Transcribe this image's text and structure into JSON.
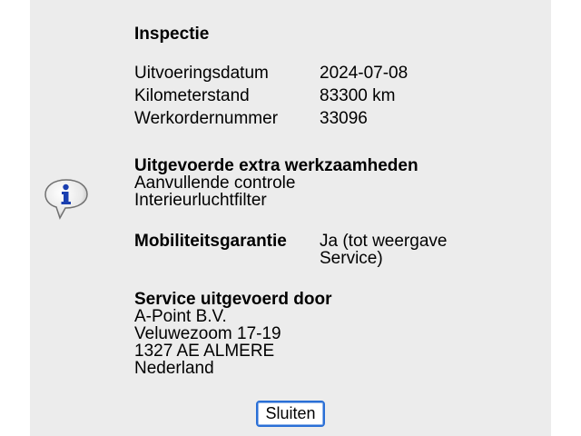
{
  "dialog": {
    "title": "Inspectie",
    "icon": "info-icon",
    "details": [
      {
        "label": "Uitvoeringsdatum",
        "value": "2024-07-08"
      },
      {
        "label": "Kilometerstand",
        "value": "83300 km"
      },
      {
        "label": "Werkordernummer",
        "value": "33096"
      }
    ],
    "extra_work": {
      "heading": "Uitgevoerde extra werkzaamheden",
      "items": [
        "Aanvullende controle",
        "Interieurluchtfilter"
      ]
    },
    "mobility": {
      "label": "Mobiliteitsgarantie",
      "value_line1": "Ja (tot weergave",
      "value_line2": "Service)"
    },
    "service_by": {
      "heading": "Service uitgevoerd door",
      "lines": [
        "A-Point B.V.",
        "Veluwezoom 17-19",
        "1327 AE ALMERE",
        "Nederland"
      ]
    },
    "close_label": "Sluiten"
  },
  "colors": {
    "panel_background": "#ececec",
    "button_border": "#2a6fd6",
    "icon_blue": "#1a3fb0"
  }
}
